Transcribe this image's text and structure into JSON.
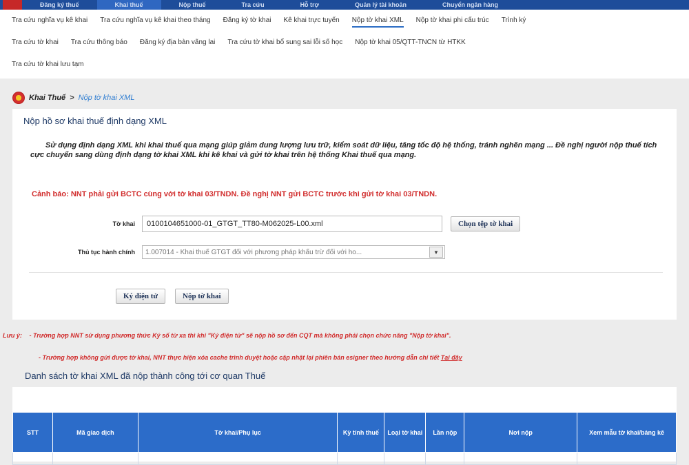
{
  "top_nav": {
    "items": [
      "Đăng ký thuế",
      "Khai thuế",
      "Nộp thuế",
      "Tra cứu",
      "Hỗ trợ",
      "Quản lý tài khoản",
      "Chuyển ngân hàng"
    ],
    "active_index": 1
  },
  "sub_nav": {
    "row1": [
      "Tra cứu nghĩa vụ kê khai",
      "Tra cứu nghĩa vụ kê khai theo tháng",
      "Đăng ký tờ khai",
      "Kê khai trực tuyến",
      "Nộp tờ khai XML",
      "Nộp tờ khai phi cấu trúc",
      "Trình ký"
    ],
    "row2": [
      "Tra cứu tờ khai",
      "Tra cứu thông báo",
      "Đăng ký địa bàn vãng lai",
      "Tra cứu tờ khai bổ sung sai lỗi số học",
      "Nộp tờ khai 05/QTT-TNCN từ HTKK"
    ],
    "row3": [
      "Tra cứu tờ khai lưu tạm"
    ],
    "active_item": "Nộp tờ khai XML"
  },
  "breadcrumb": {
    "root": "Khai Thuế",
    "separator": ">",
    "current": "Nộp tờ khai XML"
  },
  "form": {
    "title": "Nộp hồ sơ khai thuế định dạng XML",
    "intro": "Sử dụng định dạng XML khi khai thuế qua mạng giúp giảm dung lượng lưu trữ, kiểm soát dữ liệu, tăng tốc độ hệ thống, tránh nghẽn mạng ... Đề nghị người nộp thuế tích cực chuyển sang dùng định dạng tờ khai XML khi kê khai và gửi tờ khai trên hệ thống Khai thuế qua mạng.",
    "warning": "Cảnh báo: NNT phải gửi BCTC cùng với tờ khai 03/TNDN. Đề nghị NNT gửi BCTC trước khi gửi tờ khai 03/TNDN.",
    "file_label": "Tờ khai",
    "file_value": "0100104651000-01_GTGT_TT80-M062025-L00.xml",
    "choose_file_button": "Chọn tệp tờ khai",
    "procedure_label": "Thủ tục hành chính",
    "procedure_value": "1.007014 - Khai thuế GTGT đối với phương pháp khấu trừ đối với ho...",
    "sign_button": "Ký điện tử",
    "submit_button": "Nộp tờ khai"
  },
  "notes": {
    "prefix": "Lưu ý:",
    "note1": "- Trường hợp NNT sử dụng phương thức Ký số từ xa thì khi \"Ký điện tử\" sẽ nộp hồ sơ đến CQT mà không phải chọn chức năng \"Nộp tờ khai\".",
    "note2": "- Trường hợp không gửi được tờ khai, NNT thực hiện xóa cache trình duyệt hoặc cập nhật lại phiên bản esigner theo hướng dẫn chi tiết",
    "note2_link": "Tại đây"
  },
  "list": {
    "title": "Danh sách tờ khai XML đã nộp thành công tới cơ quan Thuế",
    "columns": [
      "STT",
      "Mã giao dịch",
      "Tờ khai/Phụ lục",
      "Kỳ tính thuế",
      "Loại tờ khai",
      "Lần nộp",
      "Nơi nộp",
      "Xem mẫu tờ khai/bảng kê"
    ],
    "rows": [
      [
        "",
        "",
        "",
        "",
        "",
        "",
        "",
        ""
      ]
    ]
  },
  "colors": {
    "header_blue": "#1e4d9a",
    "table_header": "#2c6cc9",
    "warning_red": "#d12d2d",
    "link_blue": "#2f7dd1"
  }
}
